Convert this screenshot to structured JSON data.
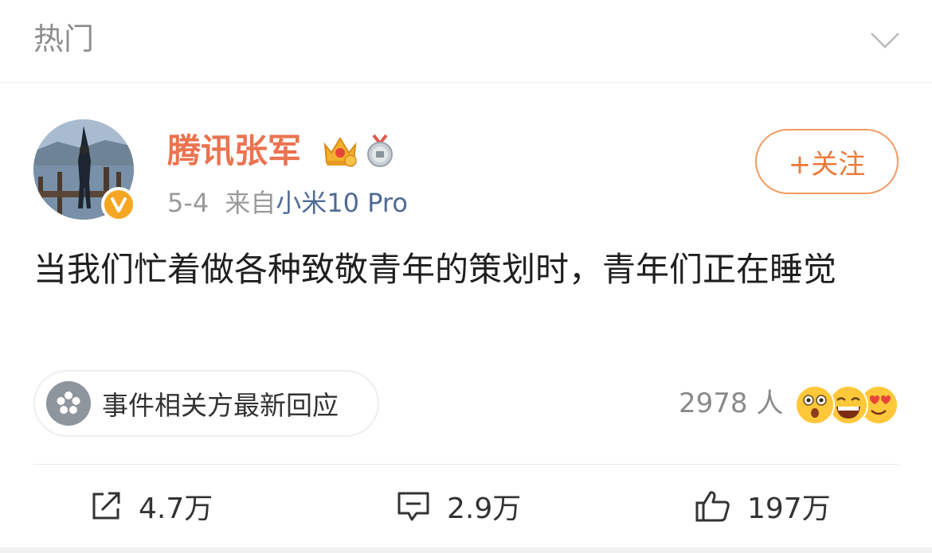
{
  "header": {
    "title": "热门",
    "collapse_icon": "chevron-down-icon"
  },
  "post": {
    "username": "腾讯张军",
    "date": "5-4",
    "source_prefix": "来自",
    "source_device": "小米10 Pro",
    "follow_label": "+关注",
    "content": "当我们忙着做各种致敬青年的策划时，青年们正在睡觉",
    "topic_label": "事件相关方最新回应",
    "reaction_count": "2978 人"
  },
  "actions": {
    "repost": "4.7万",
    "comment": "2.9万",
    "like": "197万"
  },
  "colors": {
    "username": "#eb7350",
    "follow_border": "#f39a5f",
    "device_link": "#4f6b95",
    "verified_badge": "#f5a623"
  }
}
